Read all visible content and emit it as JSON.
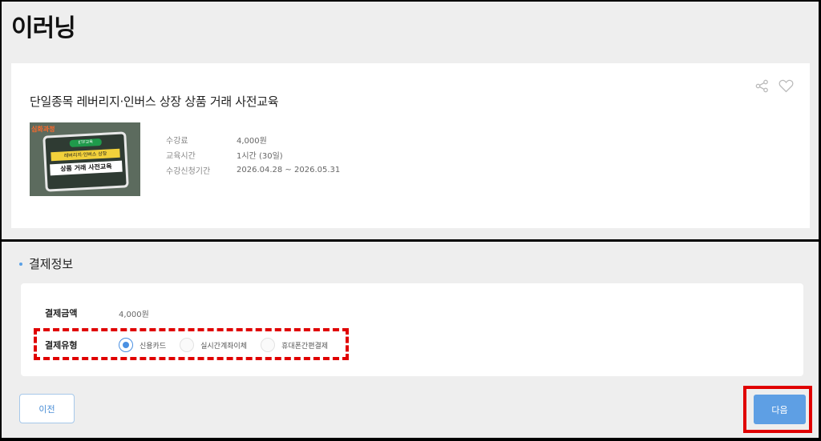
{
  "header": {
    "title": "이러닝"
  },
  "course": {
    "title": "단일종목 레버리지·인버스 상장 상품 거래 사전교육",
    "thumbnail": {
      "badge": "심화과정",
      "tag": "ETF교육",
      "line1": "레버리지·인버스 상장",
      "line2": "상품 거래 사전교육"
    },
    "info": [
      {
        "label": "수강료",
        "value": "4,000원"
      },
      {
        "label": "교육시간",
        "value": "1시간 (30일)"
      },
      {
        "label": "수강신청기간",
        "value": "2026.04.28 ~ 2026.05.31"
      }
    ],
    "actions": {
      "share_icon": "share-icon",
      "like_icon": "heart-icon"
    }
  },
  "payment": {
    "section_title": "결제정보",
    "amount_label": "결제금액",
    "amount_value": "4,000원",
    "type_label": "결제유형",
    "options": [
      {
        "label": "신용카드",
        "selected": true
      },
      {
        "label": "실시간계좌이체",
        "selected": false
      },
      {
        "label": "휴대폰간편결제",
        "selected": false
      }
    ]
  },
  "buttons": {
    "prev": "이전",
    "next": "다음"
  },
  "colors": {
    "accent": "#5e9fe4",
    "highlight": "#e00000",
    "panel": "#eeeeee"
  }
}
